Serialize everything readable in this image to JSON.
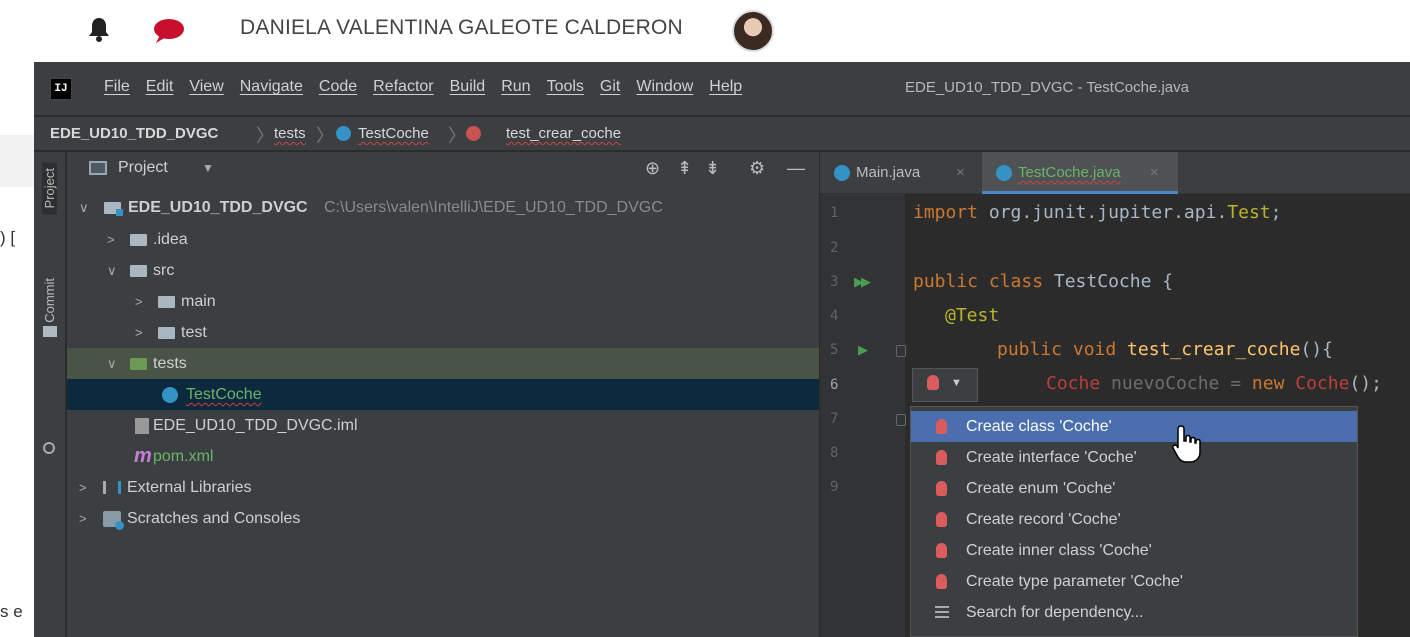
{
  "page": {
    "user_name": "DANIELA VALENTINA GALEOTE CALDERON",
    "left_fragment_top": ") [",
    "left_fragment_bottom": "s e"
  },
  "ide": {
    "logo_text": "IJ",
    "menu": [
      "File",
      "Edit",
      "View",
      "Navigate",
      "Code",
      "Refactor",
      "Build",
      "Run",
      "Tools",
      "Git",
      "Window",
      "Help"
    ],
    "window_title": "EDE_UD10_TDD_DVGC - TestCoche.java",
    "breadcrumb": {
      "project": "EDE_UD10_TDD_DVGC",
      "folder": "tests",
      "file": "TestCoche",
      "method": "test_crear_coche"
    },
    "side_tabs": {
      "project": "Project",
      "commit": "Commit"
    },
    "project_panel": {
      "title": "Project",
      "tree": [
        {
          "label": "EDE_UD10_TDD_DVGC",
          "path": "C:\\Users\\valen\\IntelliJ\\EDE_UD10_TDD_DVGC"
        },
        {
          "label": ".idea"
        },
        {
          "label": "src"
        },
        {
          "label": "main"
        },
        {
          "label": "test"
        },
        {
          "label": "tests"
        },
        {
          "label": "TestCoche"
        },
        {
          "label": "EDE_UD10_TDD_DVGC.iml"
        },
        {
          "label": "pom.xml",
          "icon_text": "m"
        },
        {
          "label": "External Libraries"
        },
        {
          "label": "Scratches and Consoles"
        }
      ]
    },
    "editor": {
      "tabs": [
        {
          "label": "Main.java",
          "close": "×"
        },
        {
          "label": "TestCoche.java",
          "close": "×"
        }
      ],
      "line_numbers": [
        "1",
        "2",
        "3",
        "4",
        "5",
        "6",
        "7",
        "8",
        "9"
      ],
      "code": {
        "l1_kw": "import",
        "l1_rest": " org.junit.jupiter.api.",
        "l1_ann": "Test",
        "l1_end": ";",
        "l3_kw": "public class",
        "l3_rest": " TestCoche {",
        "l4_ann": "@Test",
        "l5_kw": "public void",
        "l5_fn": " test_crear_coche",
        "l5_rest": "(){",
        "l6_err1": "Coche",
        "l6_dim": " nuevoCoche = ",
        "l6_kw": "new",
        "l6_err2": " Coche",
        "l6_end": "();"
      }
    },
    "intention_popup": {
      "items": [
        {
          "label": "Create class 'Coche'",
          "icon": "red-bulb-icon"
        },
        {
          "label": "Create interface 'Coche'",
          "icon": "red-bulb-icon"
        },
        {
          "label": "Create enum 'Coche'",
          "icon": "red-bulb-icon"
        },
        {
          "label": "Create record 'Coche'",
          "icon": "red-bulb-icon"
        },
        {
          "label": "Create inner class 'Coche'",
          "icon": "red-bulb-icon"
        },
        {
          "label": "Create type parameter 'Coche'",
          "icon": "red-bulb-icon"
        },
        {
          "label": "Search for dependency...",
          "icon": "stack-icon"
        }
      ]
    },
    "colors": {
      "selection": "#4b6eaf",
      "keyword": "#cc7832",
      "error": "#bc3f3c",
      "function": "#ffc66d"
    }
  }
}
